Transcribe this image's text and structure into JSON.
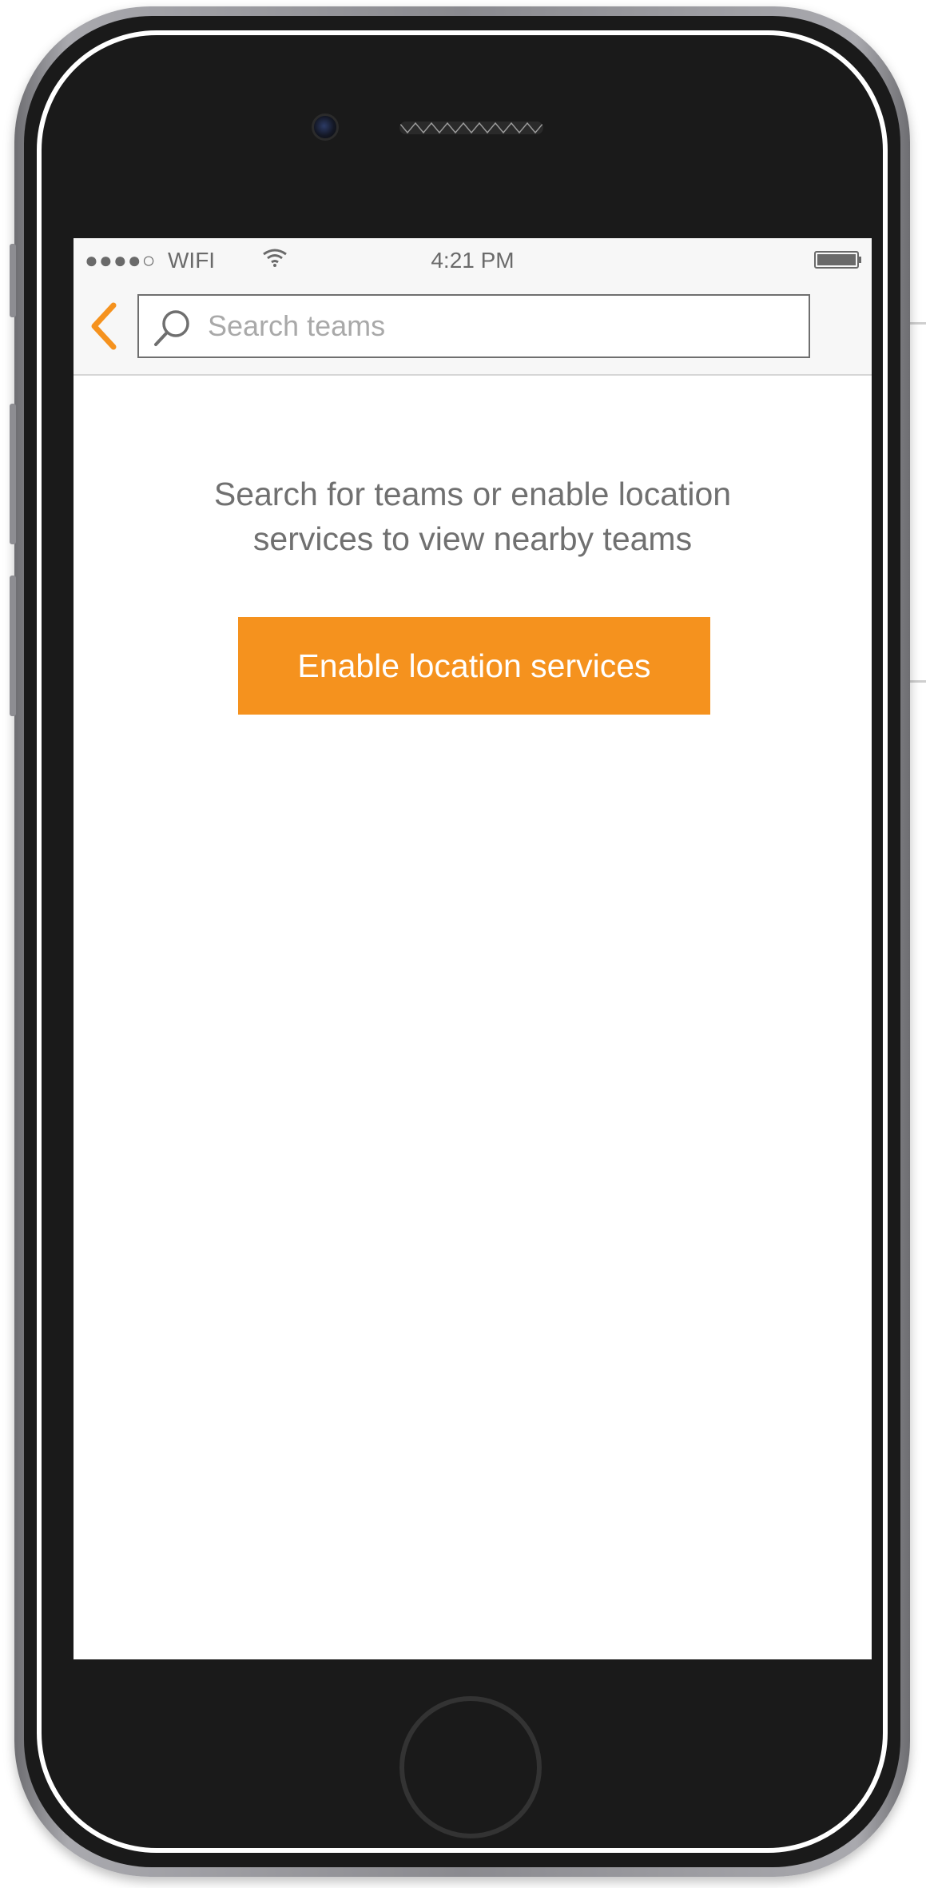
{
  "status_bar": {
    "signal": "●●●●○",
    "carrier": "WIFI",
    "time": "4:21 PM",
    "wifi_icon": "wifi-icon",
    "battery_icon": "battery-icon"
  },
  "nav": {
    "back_icon": "chevron-left-icon",
    "search_icon": "magnifier-icon",
    "search_placeholder": "Search teams",
    "search_value": ""
  },
  "main": {
    "prompt_line1": "Search for teams or enable location",
    "prompt_line2": "services to view nearby teams",
    "cta_label": "Enable location services"
  },
  "colors": {
    "accent": "#f5921e",
    "text_muted": "#707070",
    "nav_background": "#f7f7f7",
    "phone_body": "#1a1a1a"
  }
}
